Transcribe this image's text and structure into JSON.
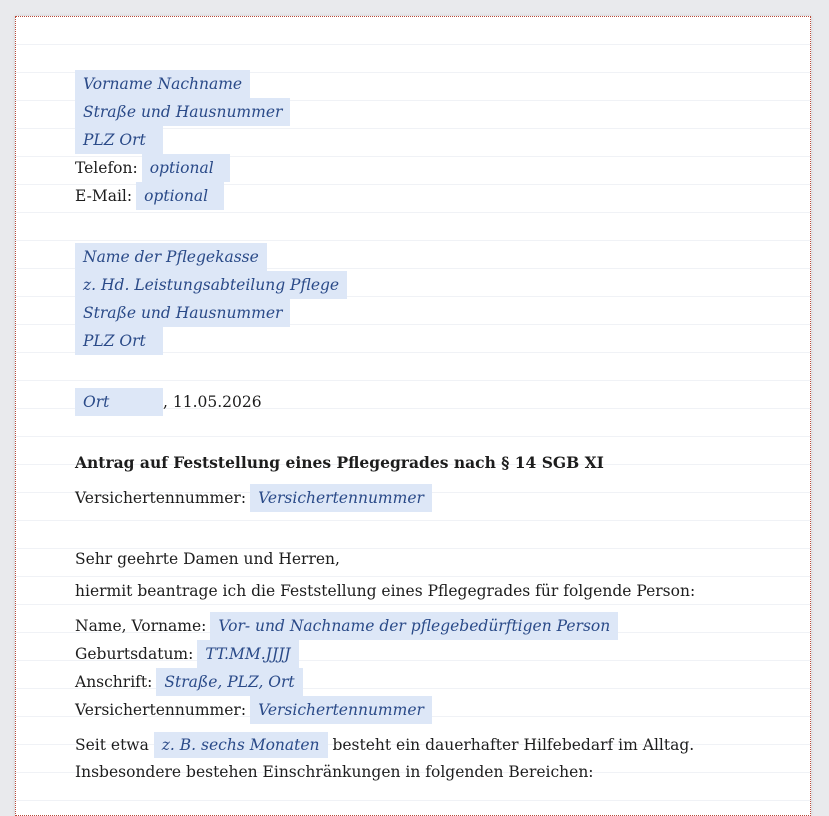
{
  "sender": {
    "name": "Vorname Nachname",
    "street": "Straße und Hausnummer",
    "city": "PLZ Ort",
    "phone_label": "Telefon:",
    "phone_value": "optional",
    "email_label": "E-Mail:",
    "email_value": "optional"
  },
  "recipient": {
    "name": "Name der Pflegekasse",
    "attention": "z. Hd. Leistungsabteilung Pflege",
    "street": "Straße und Hausnummer",
    "city": "PLZ Ort"
  },
  "date_line": {
    "place": "Ort",
    "date": ", 11.05.2026"
  },
  "subject": "Antrag auf Feststellung eines Pflegegrades nach § 14 SGB XI",
  "insured_number_label": "Versichertennummer:",
  "insured_number_value": "Versichertennummer",
  "greeting": "Sehr geehrte Damen und Herren,",
  "intro": "hiermit beantrage ich die Feststellung eines Pflegegrades für folgende Person:",
  "person": {
    "name_label": "Name, Vorname:",
    "name_value": "Vor- und Nachname der pflegebedürftigen Person",
    "birth_label": "Geburtsdatum:",
    "birth_value": "TT.MM.JJJJ",
    "address_label": "Anschrift:",
    "address_value": "Straße, PLZ, Ort",
    "insured_label": "Versichertennummer:",
    "insured_value": "Versichertennummer"
  },
  "need_paragraph": {
    "before": "Seit etwa",
    "field": "z. B. sechs Monaten",
    "after": " besteht ein dauerhafter Hilfebedarf im Alltag. Insbesondere bestehen Einschränkungen in folgenden Bereichen:"
  }
}
